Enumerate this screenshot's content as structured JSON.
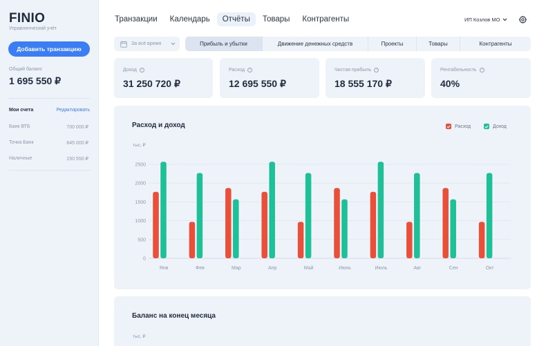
{
  "sidebar": {
    "logo": "FINIO",
    "subtitle": "Управленческий учёт",
    "add_button": "Добавить транзакцию",
    "balance_label": "Общий баланс",
    "balance_value": "1 695 550 ₽",
    "accounts_title": "Мои счета",
    "accounts_edit": "Редактировать",
    "accounts": [
      {
        "name": "Банк ВТБ",
        "amount": "700 000 ₽"
      },
      {
        "name": "Точка Банк",
        "amount": "845 000 ₽"
      },
      {
        "name": "Наличные",
        "amount": "150 550 ₽"
      }
    ]
  },
  "nav": {
    "items": [
      "Транзакции",
      "Календарь",
      "Отчёты",
      "Товары",
      "Контрагенты"
    ],
    "active": "Отчёты",
    "user": "ИП Козлов МО",
    "settings_icon": "gear-icon"
  },
  "period": {
    "label": "За всё время",
    "icon": "calendar-icon"
  },
  "tabs": {
    "items": [
      "Прибыль и убытки",
      "Движение денежных средств",
      "Проекты",
      "Товары",
      "Контрагенты"
    ],
    "active": "Прибыль и убытки"
  },
  "stats": [
    {
      "label": "Доход",
      "value": "31 250 720 ₽"
    },
    {
      "label": "Расход",
      "value": "12 695 550 ₽"
    },
    {
      "label": "Чистая прибыль",
      "value": "18 555 170 ₽"
    },
    {
      "label": "Рентабельность",
      "value": "40%"
    }
  ],
  "colors": {
    "expense": "#e8503a",
    "income": "#1fbf98",
    "accent": "#3b7df5"
  },
  "chart_data": {
    "type": "bar",
    "title": "Расход и доход",
    "ylabel": "тыс, ₽",
    "ylim": [
      0,
      2500
    ],
    "yticks": [
      0,
      500,
      1000,
      1500,
      2000,
      2500
    ],
    "categories": [
      "Янв",
      "Фев",
      "Мар",
      "Апр",
      "Май",
      "Июнь",
      "Июль",
      "Авг",
      "Сен",
      "Окт"
    ],
    "series": [
      {
        "name": "Расход",
        "values": [
          1770,
          970,
          1870,
          1770,
          970,
          1870,
          1770,
          970,
          1870,
          970
        ]
      },
      {
        "name": "Доход",
        "values": [
          2570,
          2270,
          1570,
          2570,
          2270,
          1570,
          2570,
          2270,
          1570,
          2270
        ]
      }
    ],
    "grid": true,
    "legend": "top-right"
  },
  "balance_panel": {
    "title": "Баланс на конец месяца",
    "unit": "тыс, ₽"
  }
}
